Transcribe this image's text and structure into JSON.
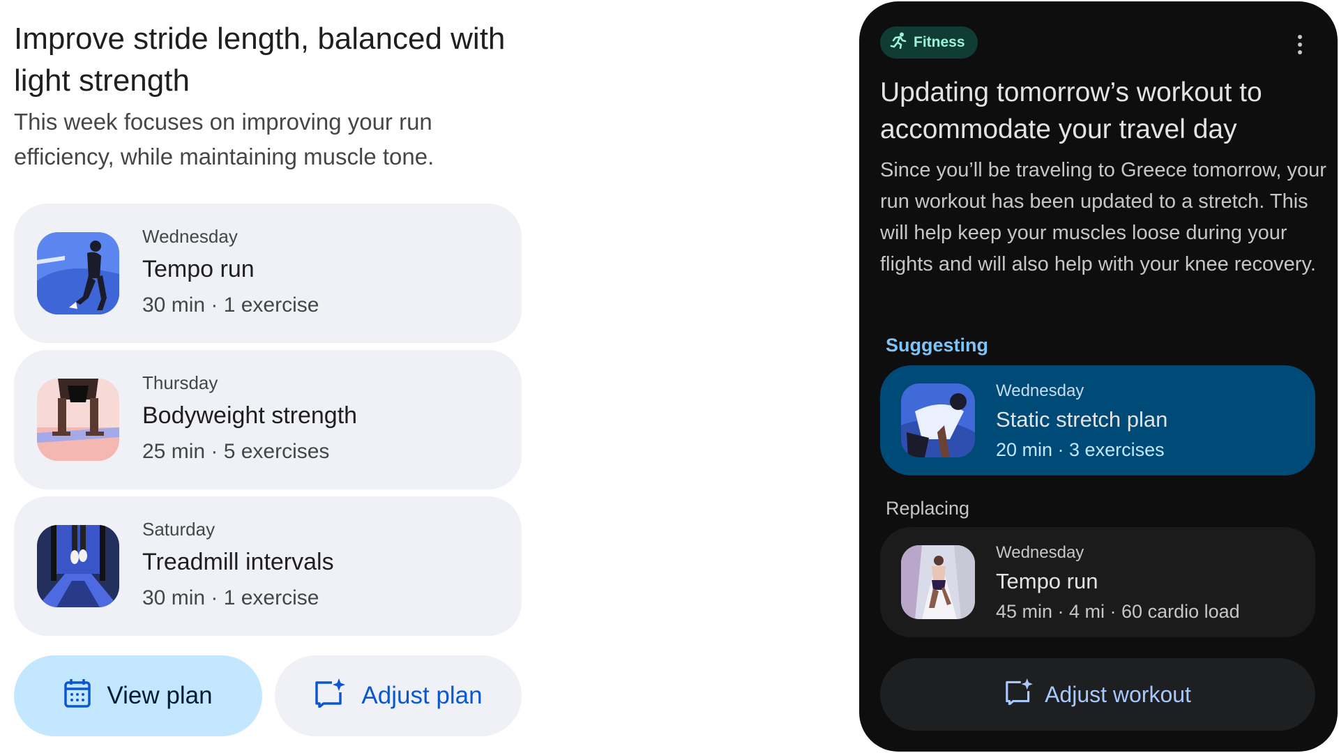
{
  "left": {
    "title": "Improve stride length, balanced with light strength",
    "subtitle": "This week focuses on improving your run efficiency, while maintaining muscle tone.",
    "plans": [
      {
        "day": "Wednesday",
        "name": "Tempo run",
        "meta": "30 min · 1 exercise",
        "thumb": "runner-illustration"
      },
      {
        "day": "Thursday",
        "name": "Bodyweight strength",
        "meta": "25 min · 5 exercises",
        "thumb": "plank-illustration"
      },
      {
        "day": "Saturday",
        "name": "Treadmill intervals",
        "meta": "30 min · 1 exercise",
        "thumb": "treadmill-illustration"
      }
    ],
    "actions": {
      "view_plan": "View plan",
      "view_plan_icon": "calendar-icon",
      "adjust_plan": "Adjust plan",
      "adjust_plan_icon": "sparkle-edit-icon"
    }
  },
  "phone": {
    "chip_label": "Fitness",
    "chip_icon": "running-person-icon",
    "menu_icon": "more-vertical-icon",
    "title": "Updating tomorrow’s workout to accommodate your travel day",
    "body": "Since you’ll be traveling to Greece tomorrow, your run workout has been updated to a stretch. This will help keep your muscles loose during your flights and will also help with your knee recovery.",
    "suggesting_label": "Suggesting",
    "suggested": {
      "day": "Wednesday",
      "name": "Static stretch plan",
      "meta": "20 min · 3 exercises"
    },
    "replacing_label": "Replacing",
    "replaced": {
      "day": "Wednesday",
      "name": "Tempo run",
      "meta": "45 min · 4 mi · 60 cardio load"
    },
    "adjust_label": "Adjust workout",
    "adjust_icon": "sparkle-edit-icon"
  },
  "colors": {
    "accent_blue": "#0b57d0",
    "view_button_bg": "#c2e7ff",
    "card_bg": "#eff1f6",
    "phone_bg": "#0e0e0e",
    "suggest_card_bg": "#004a77",
    "chip_bg": "#0f3d35",
    "chip_text": "#9ff0d6"
  }
}
